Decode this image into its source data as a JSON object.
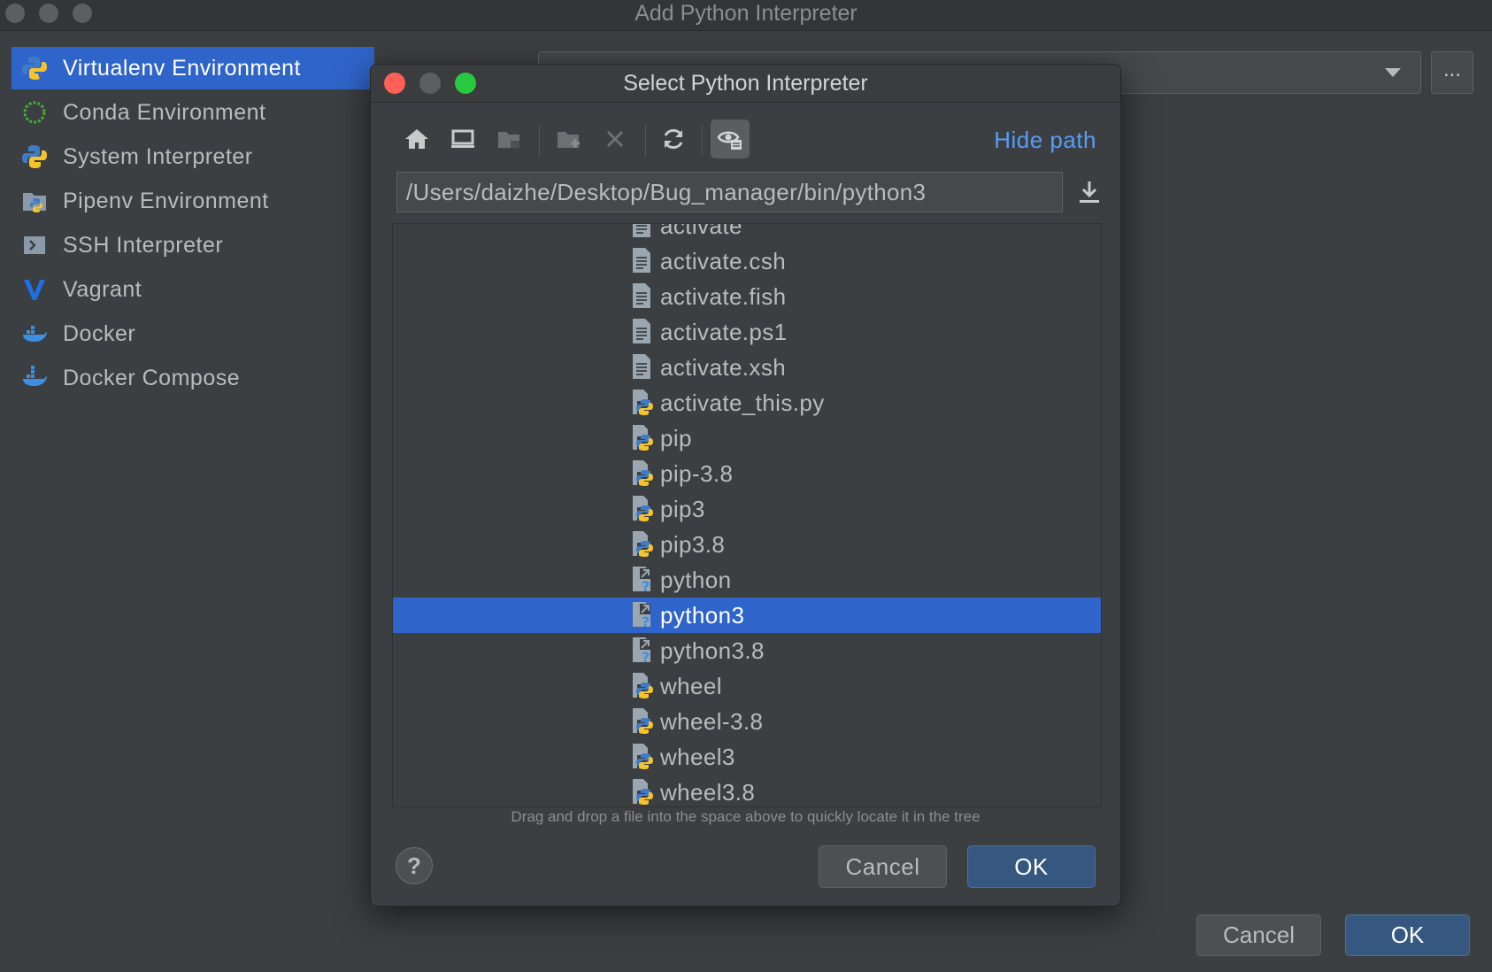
{
  "window": {
    "title": "Add Python Interpreter"
  },
  "sidebar": {
    "items": [
      {
        "label": "Virtualenv Environment",
        "icon": "python-venv-icon",
        "selected": true
      },
      {
        "label": "Conda Environment",
        "icon": "conda-icon",
        "selected": false
      },
      {
        "label": "System Interpreter",
        "icon": "python-icon",
        "selected": false
      },
      {
        "label": "Pipenv Environment",
        "icon": "pipenv-icon",
        "selected": false
      },
      {
        "label": "SSH Interpreter",
        "icon": "ssh-icon",
        "selected": false
      },
      {
        "label": "Vagrant",
        "icon": "vagrant-icon",
        "selected": false
      },
      {
        "label": "Docker",
        "icon": "docker-icon",
        "selected": false
      },
      {
        "label": "Docker Compose",
        "icon": "docker-compose-icon",
        "selected": false
      }
    ]
  },
  "outer": {
    "browse_label": "...",
    "cancel_label": "Cancel",
    "ok_label": "OK"
  },
  "dialog": {
    "title": "Select Python Interpreter",
    "hide_path_label": "Hide path",
    "path_value": "/Users/daizhe/Desktop/Bug_manager/bin/python3",
    "hint": "Drag and drop a file into the space above to quickly locate it in the tree",
    "help_label": "?",
    "cancel_label": "Cancel",
    "ok_label": "OK",
    "files": [
      {
        "name": "activate",
        "type": "text"
      },
      {
        "name": "activate.csh",
        "type": "text"
      },
      {
        "name": "activate.fish",
        "type": "text"
      },
      {
        "name": "activate.ps1",
        "type": "text"
      },
      {
        "name": "activate.xsh",
        "type": "text"
      },
      {
        "name": "activate_this.py",
        "type": "python"
      },
      {
        "name": "pip",
        "type": "python"
      },
      {
        "name": "pip-3.8",
        "type": "python"
      },
      {
        "name": "pip3",
        "type": "python"
      },
      {
        "name": "pip3.8",
        "type": "python"
      },
      {
        "name": "python",
        "type": "link"
      },
      {
        "name": "python3",
        "type": "link",
        "selected": true
      },
      {
        "name": "python3.8",
        "type": "link"
      },
      {
        "name": "wheel",
        "type": "python"
      },
      {
        "name": "wheel-3.8",
        "type": "python"
      },
      {
        "name": "wheel3",
        "type": "python"
      },
      {
        "name": "wheel3.8",
        "type": "python"
      }
    ]
  },
  "colors": {
    "accent": "#2f65ca",
    "link": "#589df6",
    "close": "#fe5f57",
    "minimize": "#5c5e60",
    "zoom": "#28c840"
  }
}
